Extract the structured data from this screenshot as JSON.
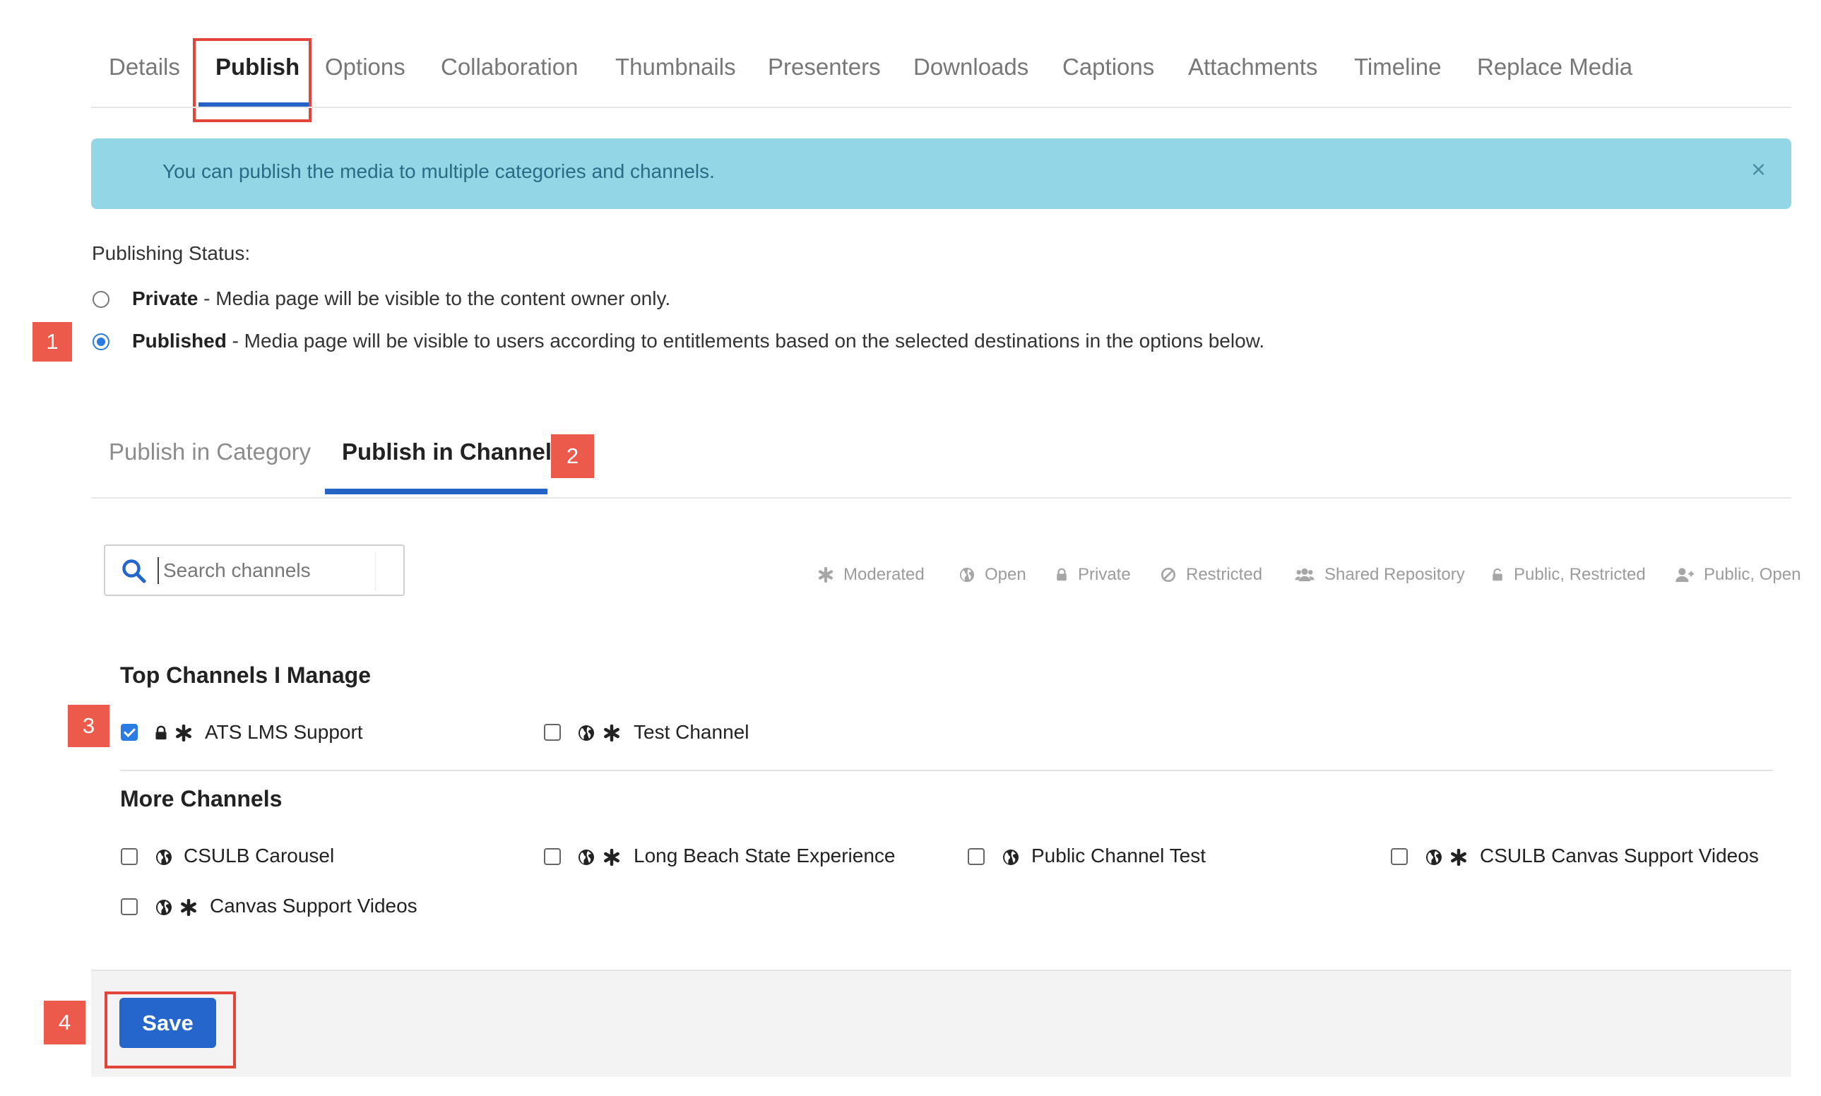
{
  "tabs": [
    {
      "label": "Details"
    },
    {
      "label": "Publish"
    },
    {
      "label": "Options"
    },
    {
      "label": "Collaboration"
    },
    {
      "label": "Thumbnails"
    },
    {
      "label": "Presenters"
    },
    {
      "label": "Downloads"
    },
    {
      "label": "Captions"
    },
    {
      "label": "Attachments"
    },
    {
      "label": "Timeline"
    },
    {
      "label": "Replace Media"
    }
  ],
  "active_tab": "Publish",
  "alert": {
    "text": "You can publish the media to multiple categories and channels.",
    "close": "×"
  },
  "publishing_status": {
    "label": "Publishing Status:",
    "options": [
      {
        "name": "Private",
        "description": " - Media page will be visible to the content owner only.",
        "selected": false
      },
      {
        "name": "Published",
        "description": " - Media page will be visible to users according to entitlements based on the selected destinations in the options below.",
        "selected": true
      }
    ]
  },
  "sub_tabs": [
    {
      "label": "Publish in Category",
      "active": false
    },
    {
      "label": "Publish in Channel",
      "active": true
    }
  ],
  "search": {
    "placeholder": "Search channels",
    "value": ""
  },
  "legend": [
    {
      "icon": "asterisk-icon",
      "label": "Moderated"
    },
    {
      "icon": "globe-icon",
      "label": "Open"
    },
    {
      "icon": "lock-icon",
      "label": "Private"
    },
    {
      "icon": "ban-icon",
      "label": "Restricted"
    },
    {
      "icon": "users-icon",
      "label": "Shared Repository"
    },
    {
      "icon": "unlock-icon",
      "label": "Public, Restricted"
    },
    {
      "icon": "user-plus-icon",
      "label": "Public, Open"
    }
  ],
  "top_channels": {
    "title": "Top Channels I Manage",
    "items": [
      {
        "label": "ATS LMS Support",
        "checked": true,
        "icons": [
          "lock-icon",
          "asterisk-icon"
        ]
      },
      {
        "label": "Test Channel",
        "checked": false,
        "icons": [
          "globe-icon",
          "asterisk-icon"
        ]
      }
    ]
  },
  "more_channels": {
    "title": "More Channels",
    "items": [
      {
        "label": "CSULB Carousel",
        "checked": false,
        "icons": [
          "globe-icon"
        ]
      },
      {
        "label": "Long Beach State Experience",
        "checked": false,
        "icons": [
          "globe-icon",
          "asterisk-icon"
        ]
      },
      {
        "label": "Public Channel Test",
        "checked": false,
        "icons": [
          "globe-icon"
        ]
      },
      {
        "label": "CSULB Canvas Support Videos",
        "checked": false,
        "icons": [
          "globe-icon",
          "asterisk-icon"
        ]
      },
      {
        "label": "Canvas Support Videos",
        "checked": false,
        "icons": [
          "globe-icon",
          "asterisk-icon"
        ]
      }
    ]
  },
  "save": {
    "label": "Save"
  },
  "callouts": [
    "1",
    "2",
    "3",
    "4"
  ],
  "colors": {
    "accent": "#2466cc",
    "alert_bg": "#93d7e6",
    "callout": "#ec5a4b",
    "highlight_border": "#e4453a"
  }
}
